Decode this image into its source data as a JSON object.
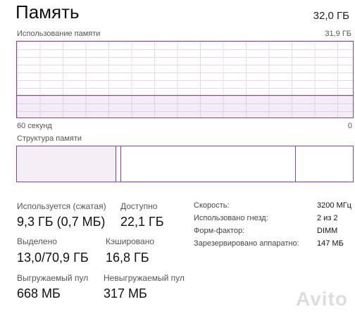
{
  "header": {
    "title": "Память",
    "total": "32,0 ГБ"
  },
  "usage_graph": {
    "label": "Использование памяти",
    "max_label": "31,9 ГБ",
    "time_left": "60 секунд",
    "time_right": "0",
    "used_fraction": 0.29
  },
  "structure": {
    "label": "Структура памяти",
    "segments": [
      {
        "name": "used",
        "fraction": 0.295
      },
      {
        "name": "modified",
        "fraction": 0.016
      },
      {
        "name": "standby",
        "fraction": 0.52
      },
      {
        "name": "free",
        "fraction": 0.169
      }
    ]
  },
  "stats": {
    "in_use_label": "Используется (сжатая)",
    "in_use_value": "9,3 ГБ (0,7 МБ)",
    "available_label": "Доступно",
    "available_value": "22,1 ГБ",
    "committed_label": "Выделено",
    "committed_value": "13,0/70,9 ГБ",
    "cached_label": "Кэшировано",
    "cached_value": "16,8 ГБ",
    "paged_label": "Выгружаемый пул",
    "paged_value": "668 МБ",
    "nonpaged_label": "Невыгружаемый пул",
    "nonpaged_value": "317 МБ"
  },
  "details": [
    {
      "label": "Скорость:",
      "value": "3200 МГц"
    },
    {
      "label": "Использовано гнезд:",
      "value": "2 из 2"
    },
    {
      "label": "Форм-фактор:",
      "value": "DIMM"
    },
    {
      "label": "Зарезервировано аппаратно:",
      "value": "147 МБ"
    }
  ],
  "watermark": "Avito"
}
